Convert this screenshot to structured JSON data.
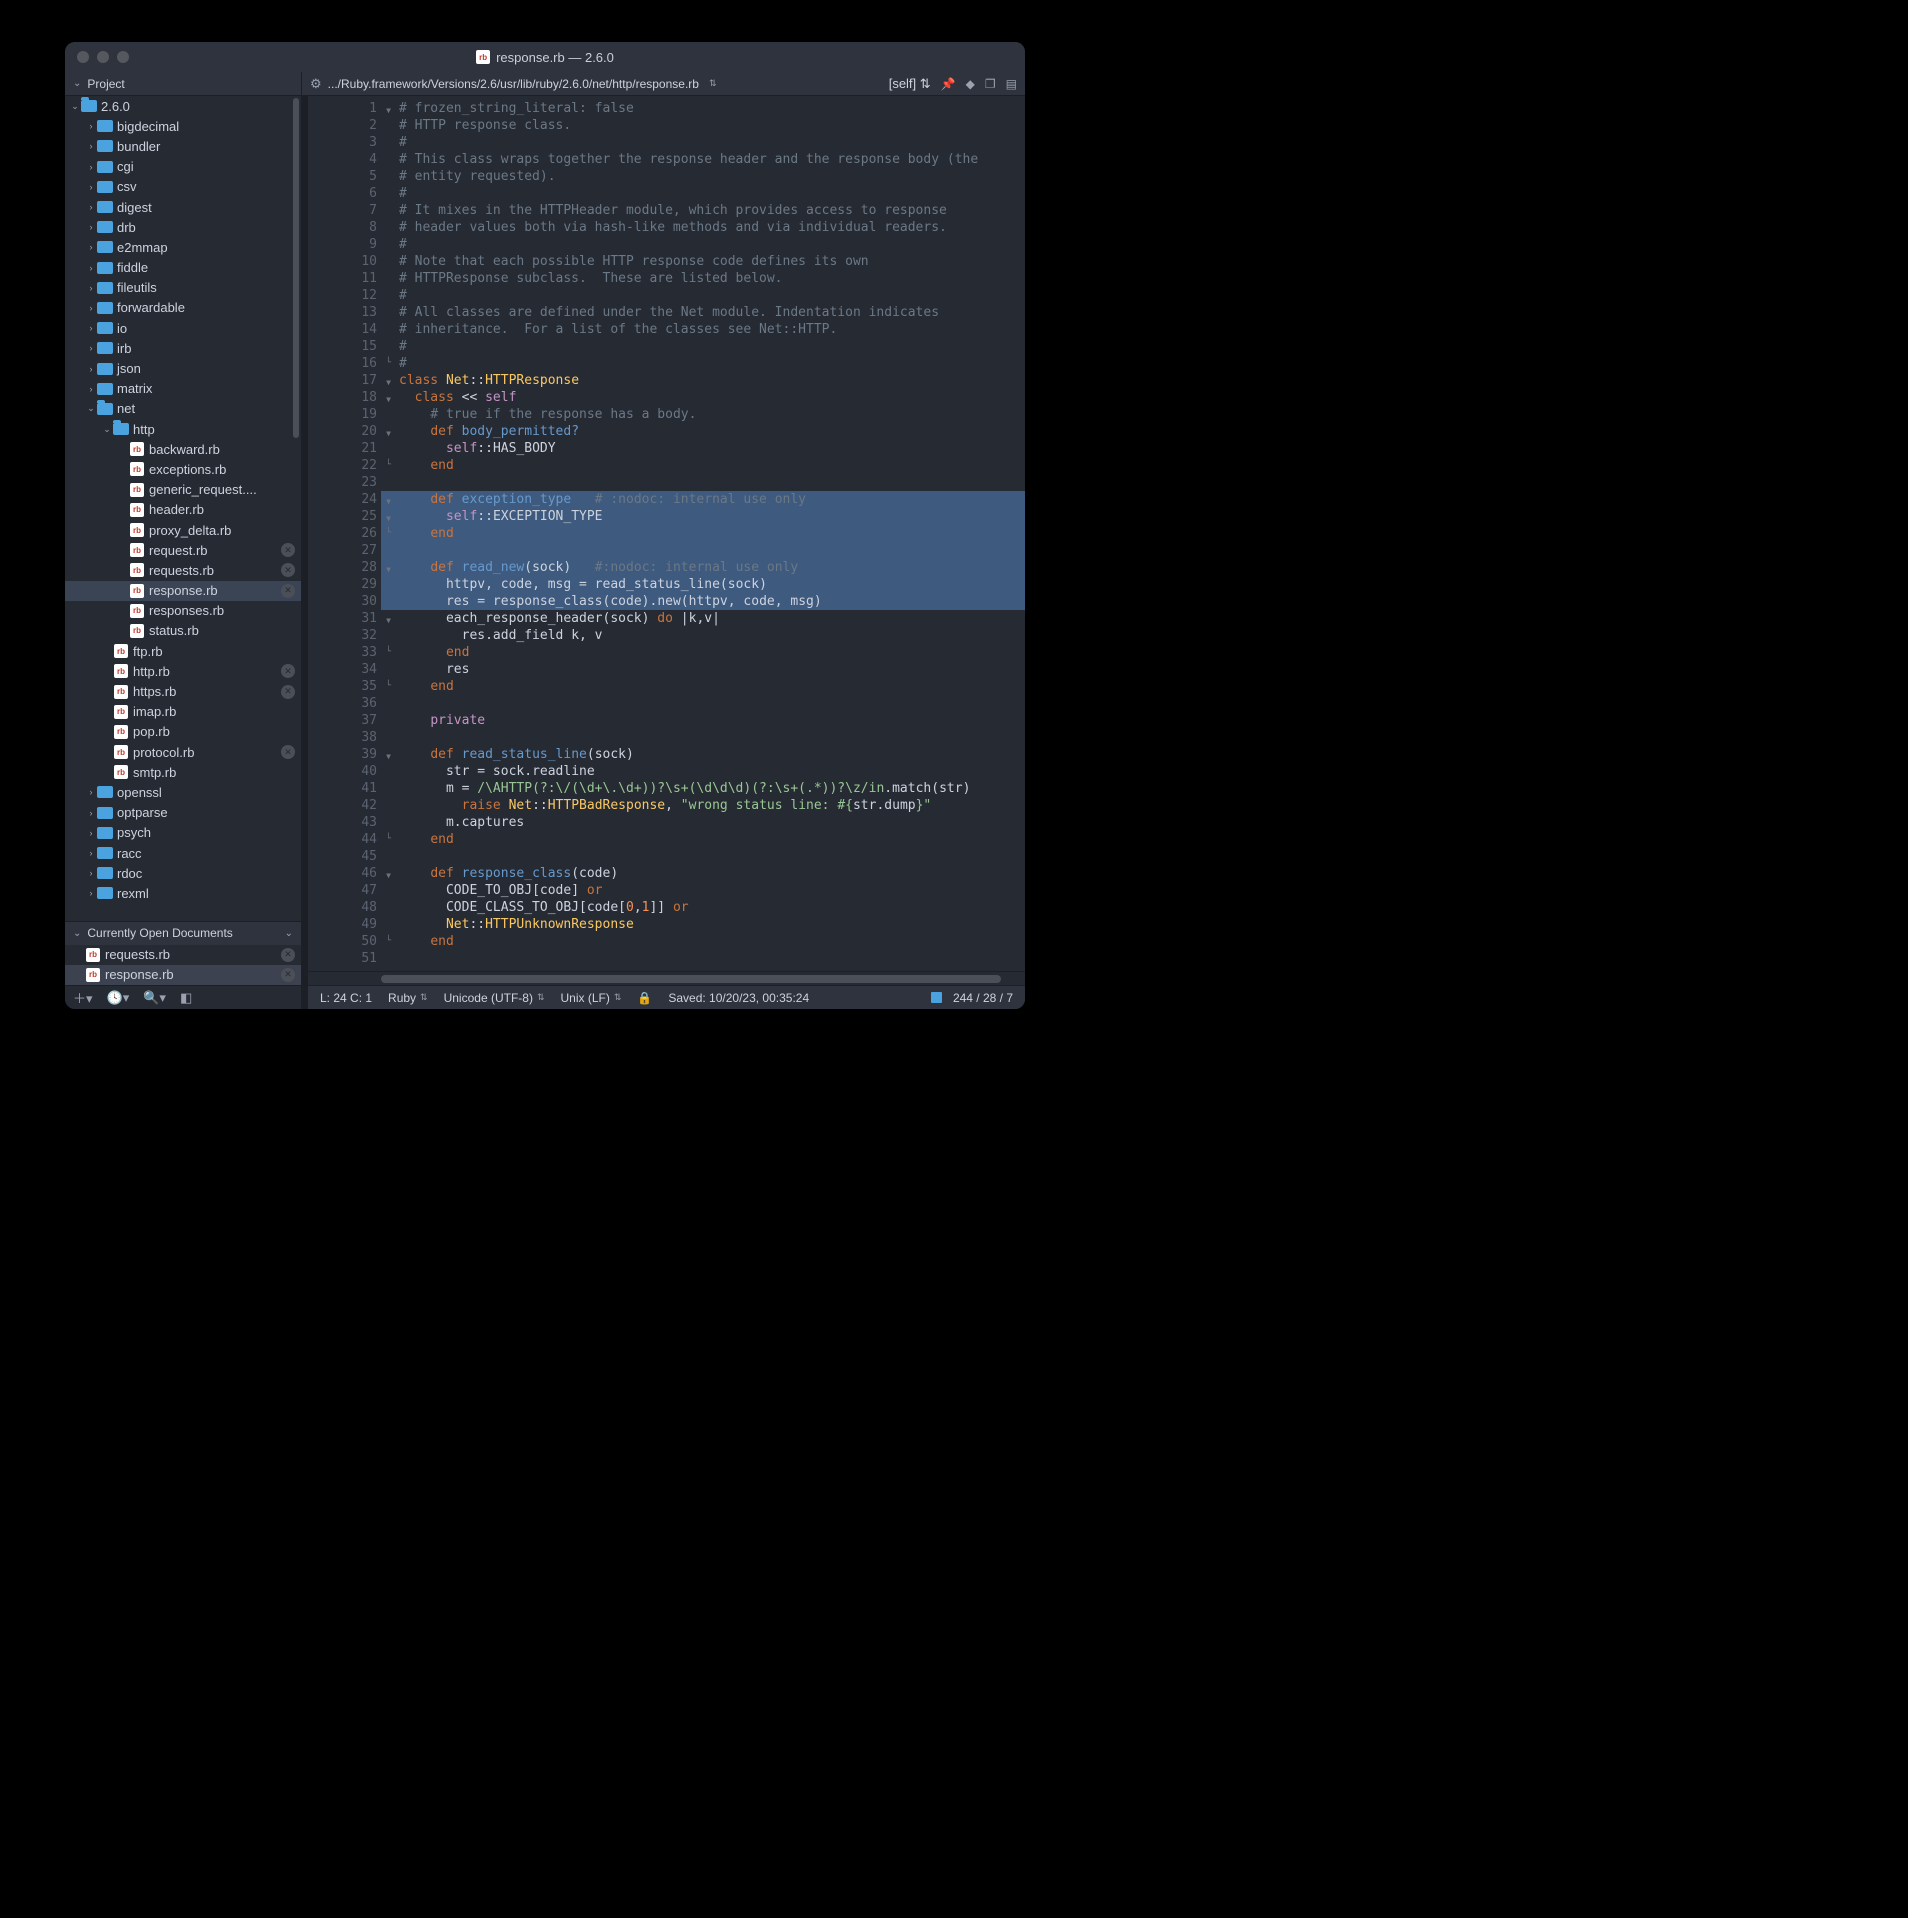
{
  "window": {
    "title": "response.rb — 2.6.0"
  },
  "toolbar": {
    "project_label": "Project",
    "path": ".../Ruby.framework/Versions/2.6/usr/lib/ruby/2.6.0/net/http/response.rb",
    "scope": "[self]"
  },
  "sidebar": {
    "root": "2.6.0",
    "tree": [
      {
        "d": 1,
        "t": "folder",
        "n": "bigdecimal"
      },
      {
        "d": 1,
        "t": "folder",
        "n": "bundler"
      },
      {
        "d": 1,
        "t": "folder",
        "n": "cgi"
      },
      {
        "d": 1,
        "t": "folder",
        "n": "csv"
      },
      {
        "d": 1,
        "t": "folder",
        "n": "digest"
      },
      {
        "d": 1,
        "t": "folder",
        "n": "drb"
      },
      {
        "d": 1,
        "t": "folder",
        "n": "e2mmap"
      },
      {
        "d": 1,
        "t": "folder",
        "n": "fiddle"
      },
      {
        "d": 1,
        "t": "folder",
        "n": "fileutils"
      },
      {
        "d": 1,
        "t": "folder",
        "n": "forwardable"
      },
      {
        "d": 1,
        "t": "folder",
        "n": "io"
      },
      {
        "d": 1,
        "t": "folder",
        "n": "irb"
      },
      {
        "d": 1,
        "t": "folder",
        "n": "json"
      },
      {
        "d": 1,
        "t": "folder",
        "n": "matrix"
      },
      {
        "d": 1,
        "t": "folder",
        "n": "net",
        "open": true
      },
      {
        "d": 2,
        "t": "folder",
        "n": "http",
        "open": true
      },
      {
        "d": 3,
        "t": "rb",
        "n": "backward.rb"
      },
      {
        "d": 3,
        "t": "rb",
        "n": "exceptions.rb"
      },
      {
        "d": 3,
        "t": "rb",
        "n": "generic_request...."
      },
      {
        "d": 3,
        "t": "rb",
        "n": "header.rb"
      },
      {
        "d": 3,
        "t": "rb",
        "n": "proxy_delta.rb"
      },
      {
        "d": 3,
        "t": "rb",
        "n": "request.rb",
        "x": true
      },
      {
        "d": 3,
        "t": "rb",
        "n": "requests.rb",
        "x": true
      },
      {
        "d": 3,
        "t": "rb",
        "n": "response.rb",
        "x": true,
        "sel": true
      },
      {
        "d": 3,
        "t": "rb",
        "n": "responses.rb"
      },
      {
        "d": 3,
        "t": "rb",
        "n": "status.rb"
      },
      {
        "d": 2,
        "t": "rb",
        "n": "ftp.rb"
      },
      {
        "d": 2,
        "t": "rb",
        "n": "http.rb",
        "x": true
      },
      {
        "d": 2,
        "t": "rb",
        "n": "https.rb",
        "x": true
      },
      {
        "d": 2,
        "t": "rb",
        "n": "imap.rb"
      },
      {
        "d": 2,
        "t": "rb",
        "n": "pop.rb"
      },
      {
        "d": 2,
        "t": "rb",
        "n": "protocol.rb",
        "x": true
      },
      {
        "d": 2,
        "t": "rb",
        "n": "smtp.rb"
      },
      {
        "d": 1,
        "t": "folder",
        "n": "openssl"
      },
      {
        "d": 1,
        "t": "folder",
        "n": "optparse"
      },
      {
        "d": 1,
        "t": "folder",
        "n": "psych"
      },
      {
        "d": 1,
        "t": "folder",
        "n": "racc"
      },
      {
        "d": 1,
        "t": "folder",
        "n": "rdoc"
      },
      {
        "d": 1,
        "t": "folder",
        "n": "rexml"
      }
    ],
    "open_docs_label": "Currently Open Documents",
    "open_docs": [
      {
        "n": "requests.rb"
      },
      {
        "n": "response.rb",
        "sel": true
      }
    ]
  },
  "code": {
    "lines": [
      {
        "n": 1,
        "f": "v",
        "s": [
          [
            "cm",
            "# frozen_string_literal: false"
          ]
        ]
      },
      {
        "n": 2,
        "s": [
          [
            "cm",
            "# HTTP response class."
          ]
        ]
      },
      {
        "n": 3,
        "s": [
          [
            "cm",
            "#"
          ]
        ]
      },
      {
        "n": 4,
        "s": [
          [
            "cm",
            "# This class wraps together the response header and the response body (the"
          ]
        ]
      },
      {
        "n": 5,
        "s": [
          [
            "cm",
            "# entity requested)."
          ]
        ]
      },
      {
        "n": 6,
        "s": [
          [
            "cm",
            "#"
          ]
        ]
      },
      {
        "n": 7,
        "s": [
          [
            "cm",
            "# It mixes in the HTTPHeader module, which provides access to response"
          ]
        ]
      },
      {
        "n": 8,
        "s": [
          [
            "cm",
            "# header values both via hash-like methods and via individual readers."
          ]
        ]
      },
      {
        "n": 9,
        "s": [
          [
            "cm",
            "#"
          ]
        ]
      },
      {
        "n": 10,
        "s": [
          [
            "cm",
            "# Note that each possible HTTP response code defines its own"
          ]
        ]
      },
      {
        "n": 11,
        "s": [
          [
            "cm",
            "# HTTPResponse subclass.  These are listed below."
          ]
        ]
      },
      {
        "n": 12,
        "s": [
          [
            "cm",
            "#"
          ]
        ]
      },
      {
        "n": 13,
        "s": [
          [
            "cm",
            "# All classes are defined under the Net module. Indentation indicates"
          ]
        ]
      },
      {
        "n": 14,
        "s": [
          [
            "cm",
            "# inheritance.  For a list of the classes see Net::HTTP."
          ]
        ]
      },
      {
        "n": 15,
        "s": [
          [
            "cm",
            "#"
          ]
        ]
      },
      {
        "n": 16,
        "f": "L",
        "s": [
          [
            "cm",
            "#"
          ]
        ]
      },
      {
        "n": 17,
        "f": "v",
        "s": [
          [
            "kw2",
            "class"
          ],
          [
            "id",
            " "
          ],
          [
            "cls",
            "Net"
          ],
          [
            "op",
            "::"
          ],
          [
            "cls",
            "HTTPResponse"
          ]
        ]
      },
      {
        "n": 18,
        "f": "v",
        "s": [
          [
            "id",
            "  "
          ],
          [
            "kw2",
            "class"
          ],
          [
            "id",
            " "
          ],
          [
            "op",
            "<<"
          ],
          [
            "id",
            " "
          ],
          [
            "kw",
            "self"
          ]
        ]
      },
      {
        "n": 19,
        "s": [
          [
            "id",
            "    "
          ],
          [
            "cm",
            "# true if the response has a body."
          ]
        ]
      },
      {
        "n": 20,
        "f": "v",
        "s": [
          [
            "id",
            "    "
          ],
          [
            "kw2",
            "def"
          ],
          [
            "id",
            " "
          ],
          [
            "fn",
            "body_permitted?"
          ]
        ]
      },
      {
        "n": 21,
        "s": [
          [
            "id",
            "      "
          ],
          [
            "kw",
            "self"
          ],
          [
            "op",
            "::"
          ],
          [
            "id",
            "HAS_BODY"
          ]
        ]
      },
      {
        "n": 22,
        "f": "L",
        "s": [
          [
            "id",
            "    "
          ],
          [
            "kw2",
            "end"
          ]
        ]
      },
      {
        "n": 23,
        "s": []
      },
      {
        "n": 24,
        "f": "v",
        "hl": true,
        "s": [
          [
            "id",
            "    "
          ],
          [
            "kw2",
            "def"
          ],
          [
            "id",
            " "
          ],
          [
            "fn",
            "exception_type"
          ],
          [
            "id",
            "   "
          ],
          [
            "cm",
            "# :nodoc: internal use only"
          ]
        ]
      },
      {
        "n": 25,
        "f": "v",
        "hl": true,
        "s": [
          [
            "id",
            "      "
          ],
          [
            "kw",
            "self"
          ],
          [
            "op",
            "::"
          ],
          [
            "id",
            "EXCEPTION_TYPE"
          ]
        ]
      },
      {
        "n": 26,
        "f": "L",
        "hl": true,
        "s": [
          [
            "id",
            "    "
          ],
          [
            "kw2",
            "end"
          ]
        ]
      },
      {
        "n": 27,
        "hl": true,
        "s": []
      },
      {
        "n": 28,
        "f": "v",
        "hl": true,
        "s": [
          [
            "id",
            "    "
          ],
          [
            "kw2",
            "def"
          ],
          [
            "id",
            " "
          ],
          [
            "fn",
            "read_new"
          ],
          [
            "op",
            "("
          ],
          [
            "id",
            "sock"
          ],
          [
            "op",
            ")"
          ],
          [
            "id",
            "   "
          ],
          [
            "cm",
            "#:nodoc: internal use only"
          ]
        ]
      },
      {
        "n": 29,
        "hl": true,
        "s": [
          [
            "id",
            "      httpv"
          ],
          [
            "op",
            ","
          ],
          [
            "id",
            " code"
          ],
          [
            "op",
            ","
          ],
          [
            "id",
            " msg "
          ],
          [
            "op",
            "="
          ],
          [
            "id",
            " read_status_line"
          ],
          [
            "op",
            "("
          ],
          [
            "id",
            "sock"
          ],
          [
            "op",
            ")"
          ]
        ]
      },
      {
        "n": 30,
        "hl": true,
        "s": [
          [
            "id",
            "      res "
          ],
          [
            "op",
            "="
          ],
          [
            "id",
            " response_class"
          ],
          [
            "op",
            "("
          ],
          [
            "id",
            "code"
          ],
          [
            "op",
            ")."
          ],
          [
            "id",
            "new"
          ],
          [
            "op",
            "("
          ],
          [
            "id",
            "httpv"
          ],
          [
            "op",
            ","
          ],
          [
            "id",
            " code"
          ],
          [
            "op",
            ","
          ],
          [
            "id",
            " msg"
          ],
          [
            "op",
            ")"
          ]
        ]
      },
      {
        "n": 31,
        "f": "v",
        "s": [
          [
            "id",
            "      each_response_header"
          ],
          [
            "op",
            "("
          ],
          [
            "id",
            "sock"
          ],
          [
            "op",
            ")"
          ],
          [
            "id",
            " "
          ],
          [
            "kw2",
            "do"
          ],
          [
            "id",
            " "
          ],
          [
            "op",
            "|"
          ],
          [
            "id",
            "k"
          ],
          [
            "op",
            ","
          ],
          [
            "id",
            "v"
          ],
          [
            "op",
            "|"
          ]
        ]
      },
      {
        "n": 32,
        "s": [
          [
            "id",
            "        res"
          ],
          [
            "op",
            "."
          ],
          [
            "id",
            "add_field k"
          ],
          [
            "op",
            ","
          ],
          [
            "id",
            " v"
          ]
        ]
      },
      {
        "n": 33,
        "f": "L",
        "s": [
          [
            "id",
            "      "
          ],
          [
            "kw2",
            "end"
          ]
        ]
      },
      {
        "n": 34,
        "s": [
          [
            "id",
            "      res"
          ]
        ]
      },
      {
        "n": 35,
        "f": "L",
        "s": [
          [
            "id",
            "    "
          ],
          [
            "kw2",
            "end"
          ]
        ]
      },
      {
        "n": 36,
        "s": []
      },
      {
        "n": 37,
        "s": [
          [
            "id",
            "    "
          ],
          [
            "kw",
            "private"
          ]
        ]
      },
      {
        "n": 38,
        "s": []
      },
      {
        "n": 39,
        "f": "v",
        "s": [
          [
            "id",
            "    "
          ],
          [
            "kw2",
            "def"
          ],
          [
            "id",
            " "
          ],
          [
            "fn",
            "read_status_line"
          ],
          [
            "op",
            "("
          ],
          [
            "id",
            "sock"
          ],
          [
            "op",
            ")"
          ]
        ]
      },
      {
        "n": 40,
        "s": [
          [
            "id",
            "      str "
          ],
          [
            "op",
            "="
          ],
          [
            "id",
            " sock"
          ],
          [
            "op",
            "."
          ],
          [
            "id",
            "readline"
          ]
        ]
      },
      {
        "n": 41,
        "s": [
          [
            "id",
            "      m "
          ],
          [
            "op",
            "="
          ],
          [
            "id",
            " "
          ],
          [
            "rx",
            "/\\AHTTP(?:\\/(\\d+\\.\\d+))?\\s+(\\d\\d\\d)(?:\\s+(.*))?\\z/in"
          ],
          [
            "op",
            "."
          ],
          [
            "id",
            "match"
          ],
          [
            "op",
            "("
          ],
          [
            "id",
            "str"
          ],
          [
            "op",
            ")"
          ],
          [
            "id",
            " "
          ]
        ]
      },
      {
        "n": 42,
        "s": [
          [
            "id",
            "        "
          ],
          [
            "kw2",
            "raise"
          ],
          [
            "id",
            " "
          ],
          [
            "cls",
            "Net"
          ],
          [
            "op",
            "::"
          ],
          [
            "cls",
            "HTTPBadResponse"
          ],
          [
            "op",
            ","
          ],
          [
            "id",
            " "
          ],
          [
            "str",
            "\"wrong status line: #{"
          ],
          [
            "id",
            "str"
          ],
          [
            "op",
            "."
          ],
          [
            "id",
            "dump"
          ],
          [
            "str",
            "}\""
          ]
        ]
      },
      {
        "n": 43,
        "s": [
          [
            "id",
            "      m"
          ],
          [
            "op",
            "."
          ],
          [
            "id",
            "captures"
          ]
        ]
      },
      {
        "n": 44,
        "f": "L",
        "s": [
          [
            "id",
            "    "
          ],
          [
            "kw2",
            "end"
          ]
        ]
      },
      {
        "n": 45,
        "s": []
      },
      {
        "n": 46,
        "f": "v",
        "s": [
          [
            "id",
            "    "
          ],
          [
            "kw2",
            "def"
          ],
          [
            "id",
            " "
          ],
          [
            "fn",
            "response_class"
          ],
          [
            "op",
            "("
          ],
          [
            "id",
            "code"
          ],
          [
            "op",
            ")"
          ]
        ]
      },
      {
        "n": 47,
        "s": [
          [
            "id",
            "      CODE_TO_OBJ"
          ],
          [
            "op",
            "["
          ],
          [
            "id",
            "code"
          ],
          [
            "op",
            "]"
          ],
          [
            "id",
            " "
          ],
          [
            "kw2",
            "or"
          ]
        ]
      },
      {
        "n": 48,
        "s": [
          [
            "id",
            "      CODE_CLASS_TO_OBJ"
          ],
          [
            "op",
            "["
          ],
          [
            "id",
            "code"
          ],
          [
            "op",
            "["
          ],
          [
            "num",
            "0"
          ],
          [
            "op",
            ","
          ],
          [
            "num",
            "1"
          ],
          [
            "op",
            "]]"
          ],
          [
            "id",
            " "
          ],
          [
            "kw2",
            "or"
          ]
        ]
      },
      {
        "n": 49,
        "s": [
          [
            "id",
            "      "
          ],
          [
            "cls",
            "Net"
          ],
          [
            "op",
            "::"
          ],
          [
            "cls",
            "HTTPUnknownResponse"
          ]
        ]
      },
      {
        "n": 50,
        "f": "L",
        "s": [
          [
            "id",
            "    "
          ],
          [
            "kw2",
            "end"
          ]
        ]
      },
      {
        "n": 51,
        "s": []
      }
    ]
  },
  "status": {
    "pos": "L: 24 C: 1",
    "lang": "Ruby",
    "encoding": "Unicode (UTF-8)",
    "line_ending": "Unix (LF)",
    "saved": "Saved: 10/20/23, 00:35:24",
    "stats": "244 / 28 / 7"
  }
}
